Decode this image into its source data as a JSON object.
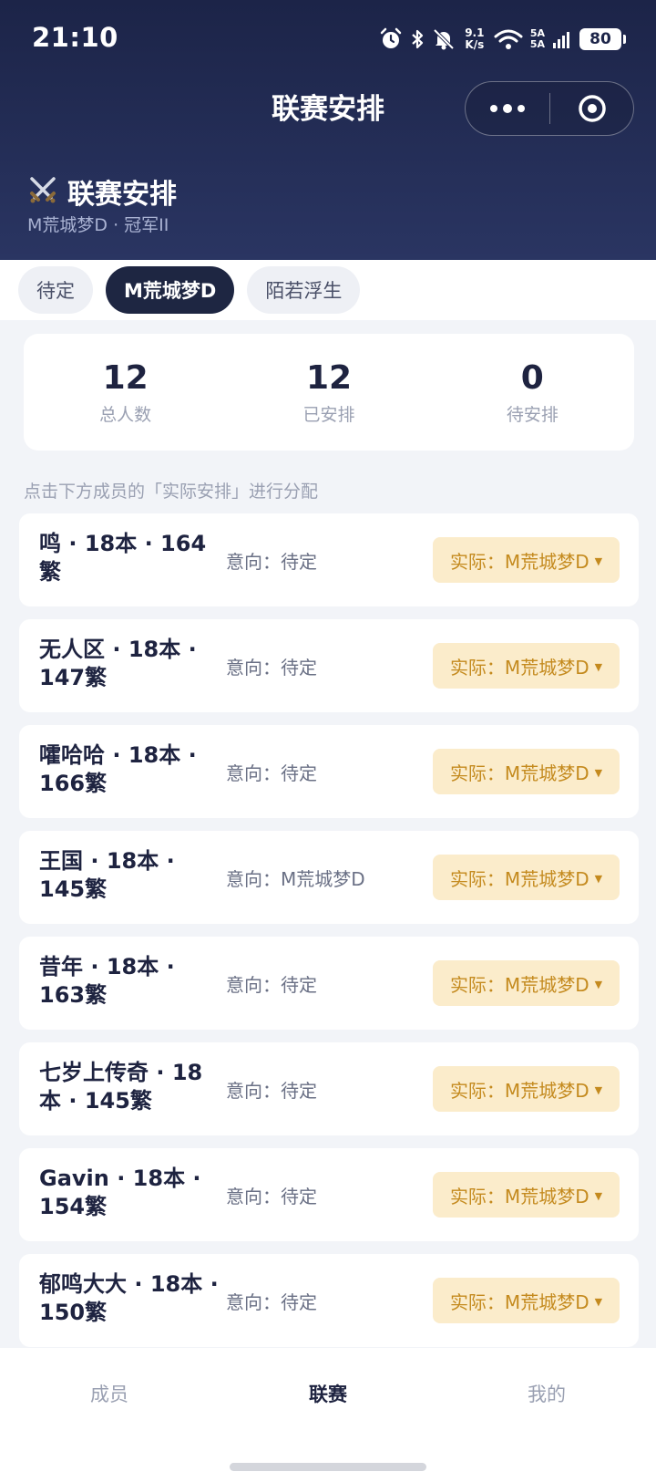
{
  "status_bar": {
    "time": "21:10",
    "net_speed_value": "9.1",
    "net_speed_unit": "K/s",
    "sig_line1": "5A",
    "sig_line2": "5A",
    "battery": "80"
  },
  "nav": {
    "title": "联赛安排"
  },
  "header": {
    "icon": "crossed-swords-icon",
    "title": "联赛安排",
    "subtitle": "M荒城梦D · 冠军II"
  },
  "tabs": [
    {
      "label": "待定",
      "active": false
    },
    {
      "label": "M荒城梦D",
      "active": true
    },
    {
      "label": "陌若浮生",
      "active": false
    }
  ],
  "stats": {
    "total": {
      "value": "12",
      "label": "总人数"
    },
    "arranged": {
      "value": "12",
      "label": "已安排"
    },
    "pending": {
      "value": "0",
      "label": "待安排"
    }
  },
  "hint": "点击下方成员的「实际安排」进行分配",
  "members": [
    {
      "name": "鸣 · 18本 · 164繁",
      "intent": "意向：待定",
      "actual": "实际：M荒城梦D"
    },
    {
      "name": "无人区 · 18本 · 147繁",
      "intent": "意向：待定",
      "actual": "实际：M荒城梦D"
    },
    {
      "name": "嚯哈哈 · 18本 · 166繁",
      "intent": "意向：待定",
      "actual": "实际：M荒城梦D"
    },
    {
      "name": "王国 · 18本 · 145繁",
      "intent": "意向：M荒城梦D",
      "actual": "实际：M荒城梦D"
    },
    {
      "name": "昔年 · 18本 · 163繁",
      "intent": "意向：待定",
      "actual": "实际：M荒城梦D"
    },
    {
      "name": "七岁上传奇 · 18本 · 145繁",
      "intent": "意向：待定",
      "actual": "实际：M荒城梦D"
    },
    {
      "name": "Gavin · 18本 · 154繁",
      "intent": "意向：待定",
      "actual": "实际：M荒城梦D"
    },
    {
      "name": "郁鸣大大 · 18本 · 150繁",
      "intent": "意向：待定",
      "actual": "实际：M荒城梦D"
    }
  ],
  "bottom_tabs": [
    {
      "label": "成员",
      "active": false
    },
    {
      "label": "联赛",
      "active": true
    },
    {
      "label": "我的",
      "active": false
    }
  ]
}
